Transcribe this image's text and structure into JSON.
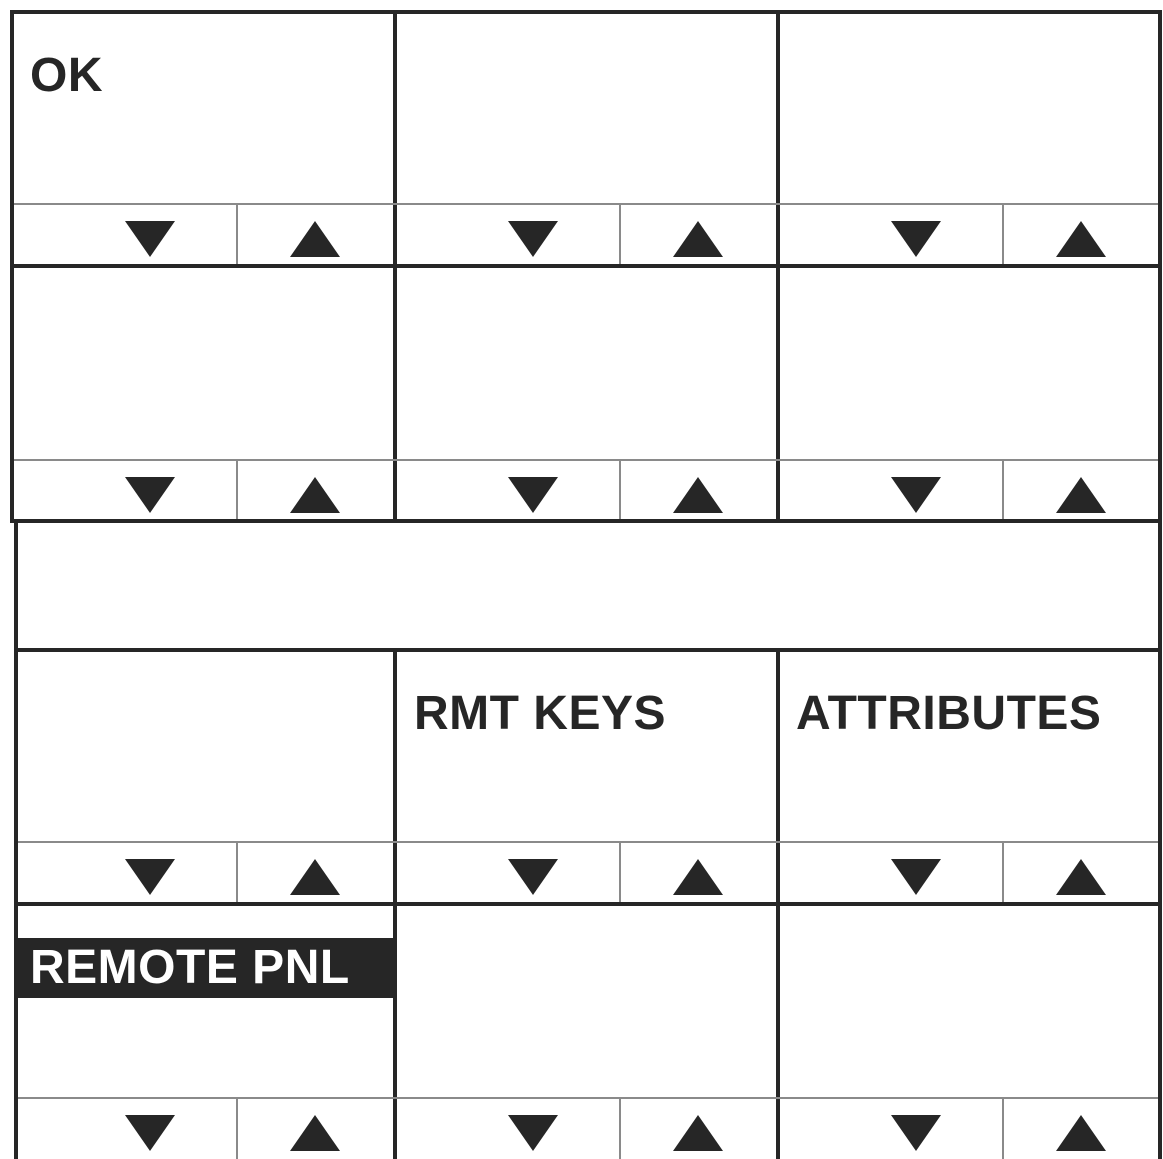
{
  "colors": {
    "ink": "#262626",
    "divider": "#8a8a8a",
    "background": "#ffffff"
  },
  "cells": [
    {
      "id": "r1c1",
      "label": "OK",
      "inverted": false
    },
    {
      "id": "r1c2",
      "label": "",
      "inverted": false
    },
    {
      "id": "r1c3",
      "label": "",
      "inverted": false
    },
    {
      "id": "r2c1",
      "label": "",
      "inverted": false
    },
    {
      "id": "r2c2",
      "label": "",
      "inverted": false
    },
    {
      "id": "r2c3",
      "label": "",
      "inverted": false
    },
    {
      "id": "r3c1",
      "label": "",
      "inverted": false
    },
    {
      "id": "r3c2",
      "label": "RMT KEYS",
      "inverted": false
    },
    {
      "id": "r3c3",
      "label": "ATTRIBUTES",
      "inverted": false
    },
    {
      "id": "r4c1",
      "label": "REMOTE PNL",
      "inverted": true
    },
    {
      "id": "r4c2",
      "label": "",
      "inverted": false
    },
    {
      "id": "r4c3",
      "label": "",
      "inverted": false
    }
  ],
  "icons": {
    "down": "down-arrow-icon",
    "up": "up-arrow-icon"
  }
}
